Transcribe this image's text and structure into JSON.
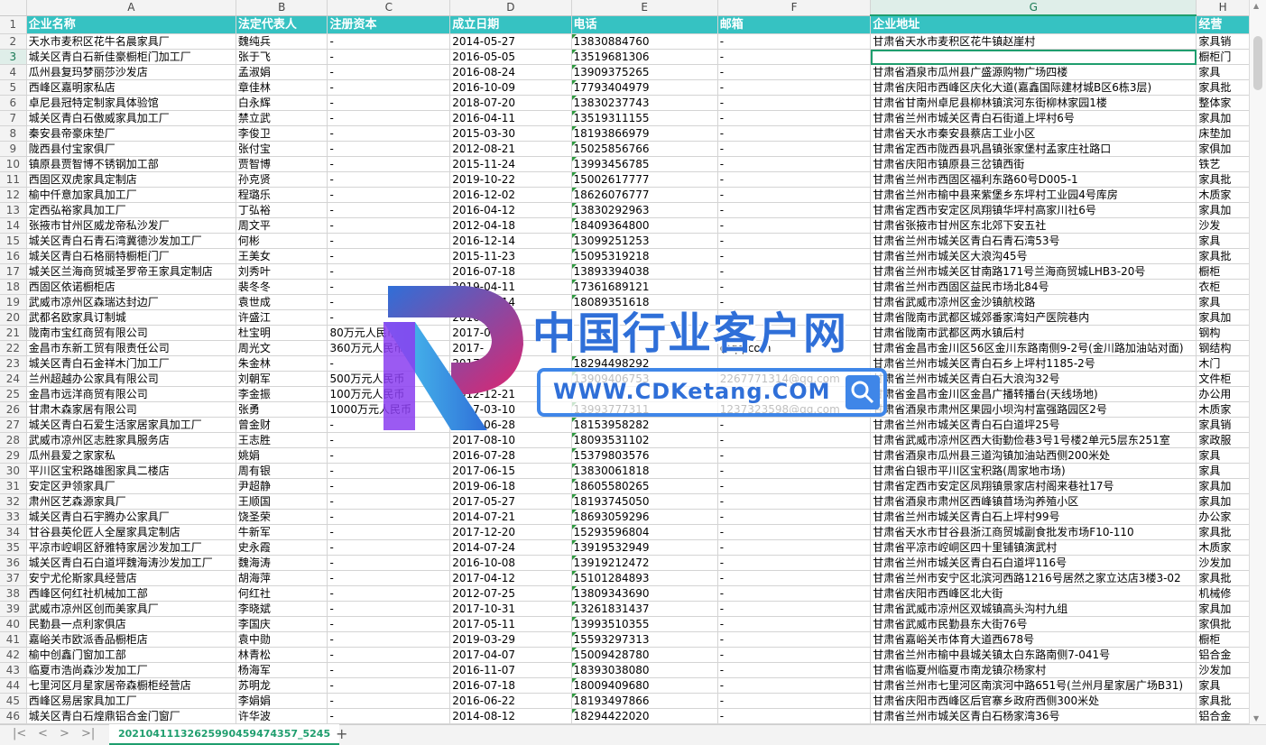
{
  "columns": [
    "A",
    "B",
    "C",
    "D",
    "E",
    "F",
    "G",
    "H"
  ],
  "selected_column": "G",
  "selected_row": 3,
  "header": [
    "企业名称",
    "法定代表人",
    "注册资本",
    "成立日期",
    "电话",
    "邮箱",
    "企业地址",
    "经营"
  ],
  "rows": [
    [
      "天水市麦积区花牛名晨家具厂",
      "魏纯兵",
      "-",
      "2014-05-27",
      "13830884760",
      "-",
      "甘肃省天水市麦积区花牛镇赵崖村",
      "家具销"
    ],
    [
      "城关区青白石新佳豪橱柜门加工厂",
      "张于飞",
      "-",
      "2016-05-05",
      "13519681306",
      "-",
      "",
      "橱柜门"
    ],
    [
      "瓜州县复玛梦丽莎沙发店",
      "孟淑娟",
      "-",
      "2016-08-24",
      "13909375265",
      "-",
      "甘肃省酒泉市瓜州县广盛源购物广场四楼",
      "家具"
    ],
    [
      "西峰区嘉明家私店",
      "章佳林",
      "-",
      "2016-10-09",
      "17793404979",
      "-",
      "甘肃省庆阳市西峰区庆化大道(嘉鑫国际建材城B区6栋3层)",
      "家具批"
    ],
    [
      "卓尼县冠特定制家具体验馆",
      "白永辉",
      "-",
      "2018-07-20",
      "13830237743",
      "-",
      "甘肃省甘南州卓尼县柳林镇滨河东街柳林家园1楼",
      "整体家"
    ],
    [
      "城关区青白石傲威家具加工厂",
      "禁立武",
      "-",
      "2016-04-11",
      "13519311155",
      "-",
      "甘肃省兰州市城关区青白石街道上坪村6号",
      "家具加"
    ],
    [
      "秦安县帝豪床垫厂",
      "李俊卫",
      "-",
      "2015-03-30",
      "18193866979",
      "-",
      "甘肃省天水市秦安县蔡店工业小区",
      "床垫加"
    ],
    [
      "陇西县付宝家俱厂",
      "张付宝",
      "-",
      "2012-08-21",
      "15025856766",
      "-",
      "甘肃省定西市陇西县巩昌镇张家堡村孟家庄社路口",
      "家俱加"
    ],
    [
      "镇原县贾智博不锈钢加工部",
      "贾智博",
      "-",
      "2015-11-24",
      "13993456785",
      "-",
      "甘肃省庆阳市镇原县三岔镇西街",
      "铁艺"
    ],
    [
      "西固区双虎家具定制店",
      "孙克贤",
      "-",
      "2019-10-22",
      "15002617777",
      "-",
      "甘肃省兰州市西固区福利东路60号D005-1",
      "家具批"
    ],
    [
      "榆中仟意加家具加工厂",
      "程璐乐",
      "-",
      "2016-12-02",
      "18626076777",
      "-",
      "甘肃省兰州市榆中县来紫堡乡东坪村工业园4号库房",
      "木质家"
    ],
    [
      "定西弘裕家具加工厂",
      "丁弘裕",
      "-",
      "2016-04-12",
      "13830292963",
      "-",
      "甘肃省定西市安定区凤翔镇华坪村高家川社6号",
      "家具加"
    ],
    [
      "张掖市甘州区威龙帝私沙发厂",
      "周文平",
      "-",
      "2012-04-18",
      "18409364800",
      "-",
      "甘肃省张掖市甘州区东北郊下安五社",
      "沙发"
    ],
    [
      "城关区青白石青石湾冀德沙发加工厂",
      "何彬",
      "-",
      "2016-12-14",
      "13099251253",
      "-",
      "甘肃省兰州市城关区青白石青石湾53号",
      "家具"
    ],
    [
      "城关区青白石格丽特橱柜门厂",
      "王美女",
      "-",
      "2015-11-23",
      "15095319218",
      "-",
      "甘肃省兰州市城关区大浪沟45号",
      "家具批"
    ],
    [
      "城关区兰海商贸城圣罗帝王家具定制店",
      "刘秀叶",
      "-",
      "2016-07-18",
      "13893394038",
      "-",
      "甘肃省兰州市城关区甘南路171号兰海商贸城LHB3-20号",
      "橱柜"
    ],
    [
      "西固区依诺橱柜店",
      "裴冬冬",
      "-",
      "2019-04-11",
      "17361689121",
      "-",
      "甘肃省兰州市西固区益民市场北84号",
      "衣柜"
    ],
    [
      "武威市凉州区森瑞达封边厂",
      "袁世成",
      "-",
      "2018-03-14",
      "18089351618",
      "-",
      "甘肃省武威市凉州区金沙镇航校路",
      "家具"
    ],
    [
      "武都名欧家具订制城",
      "许盛江",
      "-",
      "2016-06-20",
      "",
      "-",
      "甘肃省陇南市武都区城郊番家湾妇产医院巷内",
      "家具加"
    ],
    [
      "陇南市宝红商贸有限公司",
      "杜宝明",
      "80万元人民币",
      "2017-03-15",
      "",
      "",
      "甘肃省陇南市武都区两水镇后村",
      "钢构"
    ],
    [
      "金昌市东新工贸有限责任公司",
      "周光文",
      "360万元人民币",
      "2017-",
      "",
      "@qq.com",
      "甘肃省金昌市金川区56区金川东路南侧9-2号(金川路加油站对面)",
      "钢结构"
    ],
    [
      "城关区青白石金祥木门加工厂",
      "朱金林",
      "-",
      "2017-",
      "18294498292",
      "",
      "甘肃省兰州市城关区青白石乡上坪村1185-2号",
      "木门"
    ],
    [
      "兰州超越办公家具有限公司",
      "刘朝军",
      "500万元人民币",
      "2013-",
      "13909406753",
      "2267771314@qq.com",
      "甘肃省兰州市城关区青白石大浪沟32号",
      "文件柜"
    ],
    [
      "金昌市远洋商贸有限公司",
      "李金振",
      "100万元人民币",
      "2012-12-21",
      "",
      "",
      "甘肃省金昌市金川区金昌广播转播台(天线场地)",
      "办公用"
    ],
    [
      "甘肃木森家居有限公司",
      "张勇",
      "1000万元人民币",
      "2017-03-10",
      "13993777311",
      "1237323598@qq.com",
      "甘肃省酒泉市肃州区果园小坝沟村富强路园区2号",
      "木质家"
    ],
    [
      "城关区青白石爱生活家居家具加工厂",
      "曾金财",
      "-",
      "2016-06-28",
      "18153958282",
      "-",
      "甘肃省兰州市城关区青白石白道坪25号",
      "家具销"
    ],
    [
      "武威市凉州区志胜家具服务店",
      "王志胜",
      "-",
      "2017-08-10",
      "18093531102",
      "-",
      "甘肃省武威市凉州区西大街勤俭巷3号1号楼2单元5层东251室",
      "家政服"
    ],
    [
      "瓜州县爱之家家私",
      "姚娟",
      "-",
      "2016-07-28",
      "15379803576",
      "-",
      "甘肃省酒泉市瓜州县三道沟镇加油站西侧200米处",
      "家具"
    ],
    [
      "平川区宝积路雄图家具二楼店",
      "周有银",
      "-",
      "2017-06-15",
      "13830061818",
      "-",
      "甘肃省白银市平川区宝积路(周家地市场)",
      "家具"
    ],
    [
      "安定区尹领家具厂",
      "尹超静",
      "-",
      "2019-06-18",
      "18605580265",
      "-",
      "甘肃省定西市安定区凤翔镇景家店村阁来巷社17号",
      "家具加"
    ],
    [
      "肃州区艺森源家具厂",
      "王顺国",
      "-",
      "2017-05-27",
      "18193745050",
      "-",
      "甘肃省酒泉市肃州区西峰镇苜场沟养殖小区",
      "家具加"
    ],
    [
      "城关区青白石宇腾办公家具厂",
      "饶圣荣",
      "-",
      "2014-07-21",
      "18693059296",
      "-",
      "甘肃省兰州市城关区青白石上坪村99号",
      "办公家"
    ],
    [
      "甘谷县英伦匠人全屋家具定制店",
      "牛新军",
      "-",
      "2017-12-20",
      "15293596804",
      "-",
      "甘肃省天水市甘谷县浙江商贸城副食批发市场F10-110",
      "家具批"
    ],
    [
      "平凉市崆峒区舒雅特家居沙发加工厂",
      "史永霞",
      "-",
      "2014-07-24",
      "13919532949",
      "-",
      "甘肃省平凉市崆峒区四十里铺镇演武村",
      "木质家"
    ],
    [
      "城关区青白石白道坪魏海涛沙发加工厂",
      "魏海涛",
      "-",
      "2016-10-08",
      "13919212472",
      "-",
      "甘肃省兰州市城关区青白石白道坪116号",
      "沙发加"
    ],
    [
      "安宁尤伦斯家具经营店",
      "胡海萍",
      "-",
      "2017-04-12",
      "15101284893",
      "-",
      "甘肃省兰州市安宁区北滨河西路1216号居然之家立达店3楼3-02",
      "家具批"
    ],
    [
      "西峰区何红社机械加工部",
      "何红社",
      "-",
      "2012-07-25",
      "13809343690",
      "-",
      "甘肃省庆阳市西峰区北大街",
      "机械修"
    ],
    [
      "武威市凉州区创而美家具厂",
      "李晓斌",
      "-",
      "2017-10-31",
      "13261831437",
      "-",
      "甘肃省武威市凉州区双城镇高头沟村九组",
      "家具加"
    ],
    [
      "民勤县一点利家俱店",
      "李国庆",
      "-",
      "2017-05-11",
      "13993510355",
      "-",
      "甘肃省武威市民勤县东大街76号",
      "家俱批"
    ],
    [
      "嘉峪关市欧派香品橱柜店",
      "袁中勋",
      "-",
      "2019-03-29",
      "15593297313",
      "-",
      "甘肃省嘉峪关市体育大道西678号",
      "橱柜"
    ],
    [
      "榆中创鑫门窗加工部",
      "林青松",
      "-",
      "2017-04-07",
      "15009428780",
      "-",
      "甘肃省兰州市榆中县城关镇太白东路南侧7-041号",
      "铝合金"
    ],
    [
      "临夏市浩尚森沙发加工厂",
      "杨海军",
      "-",
      "2016-11-07",
      "18393038080",
      "-",
      "甘肃省临夏州临夏市南龙镇尕杨家村",
      "沙发加"
    ],
    [
      "七里河区月星家居帝森橱柜经营店",
      "苏明龙",
      "-",
      "2016-07-18",
      "18009409680",
      "-",
      "甘肃省兰州市七里河区南滨河中路651号(兰州月星家居广场B31)",
      "家具"
    ],
    [
      "西峰区易居家具加工厂",
      "李娟娟",
      "-",
      "2016-06-22",
      "18193497866",
      "-",
      "甘肃省庆阳市西峰区后官寨乡政府西侧300米处",
      "家具批"
    ],
    [
      "城关区青白石煌鼎铝合金门窗厂",
      "许华波",
      "-",
      "2014-08-12",
      "18294422020",
      "-",
      "甘肃省兰州市城关区青白石杨家湾36号",
      "铝合金"
    ]
  ],
  "sheet_tab": "20210411132625990459474357_5245",
  "watermark": {
    "title": "中国行业客户网",
    "url": "WWW.CDKetang.COM"
  }
}
